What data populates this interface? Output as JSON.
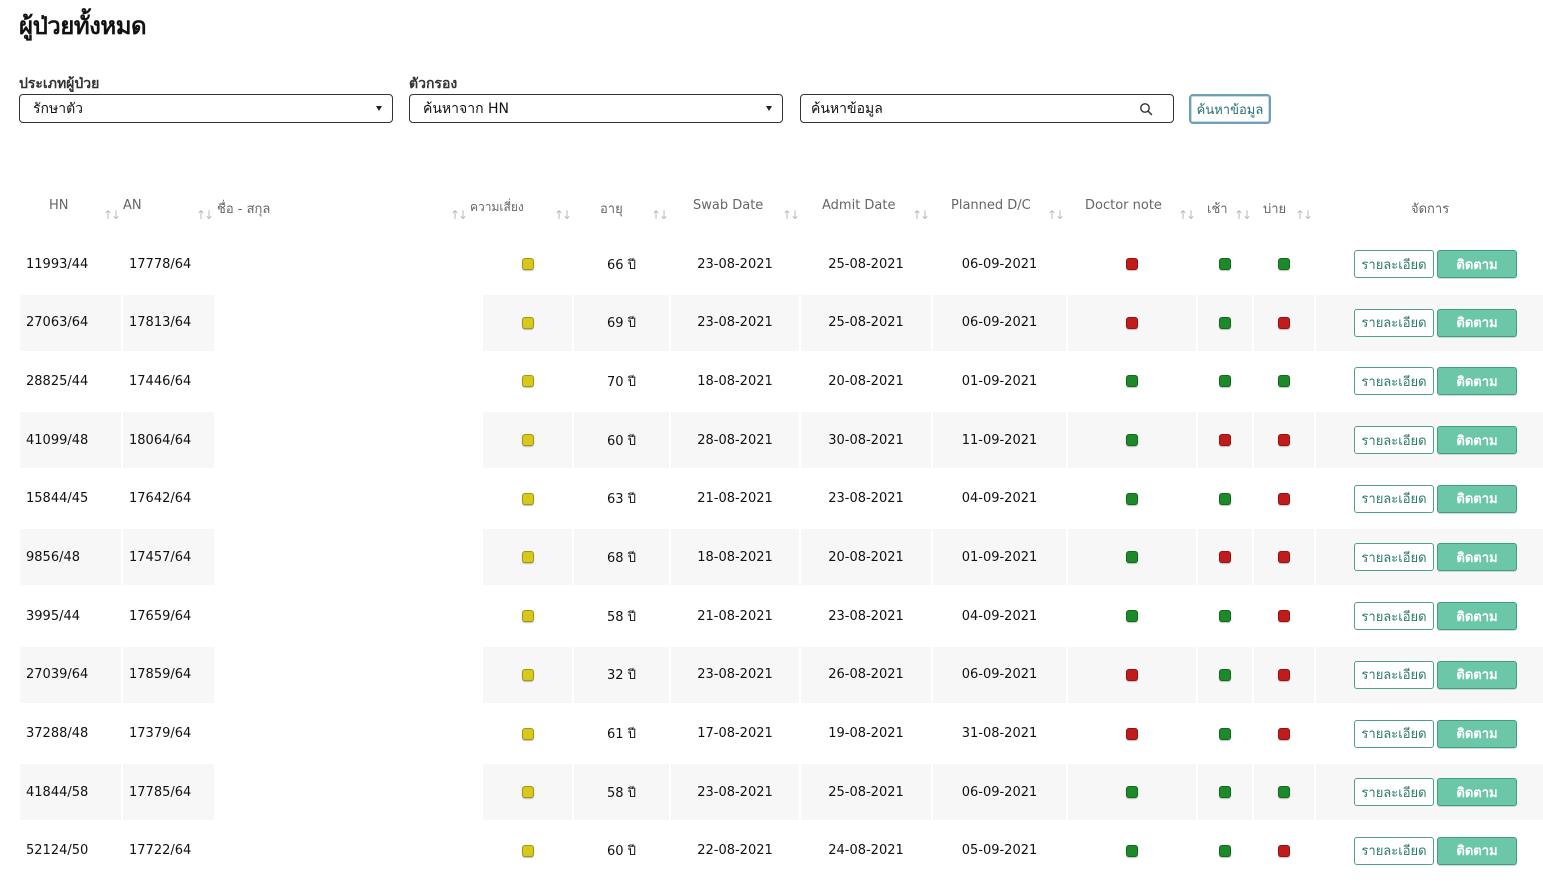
{
  "page": {
    "title": "ผู้ป่วยทั้งหมด"
  },
  "filters": {
    "patient_type_label": "ประเภทผู้ป่วย",
    "patient_type_value": "รักษาตัว",
    "filter_label": "ตัวกรอง",
    "filter_value": "ค้นหาจาก HN",
    "search_placeholder": "ค้นหาข้อมูล",
    "search_button": "ค้นหาข้อมูล"
  },
  "colors": {
    "yellow": "#d8c81c",
    "green": "#1d8a2a",
    "red": "#c21b1b",
    "accent": "#6cc7a8"
  },
  "table": {
    "headers": {
      "hn": "HN",
      "an": "AN",
      "name": "ชื่อ - สกุล",
      "risk": "ความเสี่ยง",
      "age": "อายุ",
      "swab": "Swab Date",
      "admit": "Admit Date",
      "planned": "Planned D/C",
      "doctor": "Doctor note",
      "morning": "เช้า",
      "afternoon": "บ่าย",
      "manage": "จัดการ"
    },
    "detail_label": "รายละเอียด",
    "follow_label": "ติดตาม",
    "rows": [
      {
        "hn": "11993/44",
        "an": "17778/64",
        "name": "",
        "risk": "yellow",
        "age": "66 ปี",
        "swab": "23-08-2021",
        "admit": "25-08-2021",
        "planned": "06-09-2021",
        "doctor": "red",
        "morning": "green",
        "afternoon": "green"
      },
      {
        "hn": "27063/64",
        "an": "17813/64",
        "name": "",
        "risk": "yellow",
        "age": "69 ปี",
        "swab": "23-08-2021",
        "admit": "25-08-2021",
        "planned": "06-09-2021",
        "doctor": "red",
        "morning": "green",
        "afternoon": "red"
      },
      {
        "hn": "28825/44",
        "an": "17446/64",
        "name": "",
        "risk": "yellow",
        "age": "70 ปี",
        "swab": "18-08-2021",
        "admit": "20-08-2021",
        "planned": "01-09-2021",
        "doctor": "green",
        "morning": "green",
        "afternoon": "green"
      },
      {
        "hn": "41099/48",
        "an": "18064/64",
        "name": "",
        "risk": "yellow",
        "age": "60 ปี",
        "swab": "28-08-2021",
        "admit": "30-08-2021",
        "planned": "11-09-2021",
        "doctor": "green",
        "morning": "red",
        "afternoon": "red"
      },
      {
        "hn": "15844/45",
        "an": "17642/64",
        "name": "",
        "risk": "yellow",
        "age": "63 ปี",
        "swab": "21-08-2021",
        "admit": "23-08-2021",
        "planned": "04-09-2021",
        "doctor": "green",
        "morning": "green",
        "afternoon": "red"
      },
      {
        "hn": "9856/48",
        "an": "17457/64",
        "name": "",
        "risk": "yellow",
        "age": "68 ปี",
        "swab": "18-08-2021",
        "admit": "20-08-2021",
        "planned": "01-09-2021",
        "doctor": "green",
        "morning": "red",
        "afternoon": "red"
      },
      {
        "hn": "3995/44",
        "an": "17659/64",
        "name": "",
        "risk": "yellow",
        "age": "58 ปี",
        "swab": "21-08-2021",
        "admit": "23-08-2021",
        "planned": "04-09-2021",
        "doctor": "green",
        "morning": "green",
        "afternoon": "red"
      },
      {
        "hn": "27039/64",
        "an": "17859/64",
        "name": "",
        "risk": "yellow",
        "age": "32 ปี",
        "swab": "23-08-2021",
        "admit": "26-08-2021",
        "planned": "06-09-2021",
        "doctor": "red",
        "morning": "green",
        "afternoon": "red"
      },
      {
        "hn": "37288/48",
        "an": "17379/64",
        "name": "",
        "risk": "yellow",
        "age": "61 ปี",
        "swab": "17-08-2021",
        "admit": "19-08-2021",
        "planned": "31-08-2021",
        "doctor": "red",
        "morning": "green",
        "afternoon": "red"
      },
      {
        "hn": "41844/58",
        "an": "17785/64",
        "name": "",
        "risk": "yellow",
        "age": "58 ปี",
        "swab": "23-08-2021",
        "admit": "25-08-2021",
        "planned": "06-09-2021",
        "doctor": "green",
        "morning": "green",
        "afternoon": "green"
      },
      {
        "hn": "52124/50",
        "an": "17722/64",
        "name": "",
        "risk": "yellow",
        "age": "60 ปี",
        "swab": "22-08-2021",
        "admit": "24-08-2021",
        "planned": "05-09-2021",
        "doctor": "green",
        "morning": "green",
        "afternoon": "red"
      }
    ]
  }
}
